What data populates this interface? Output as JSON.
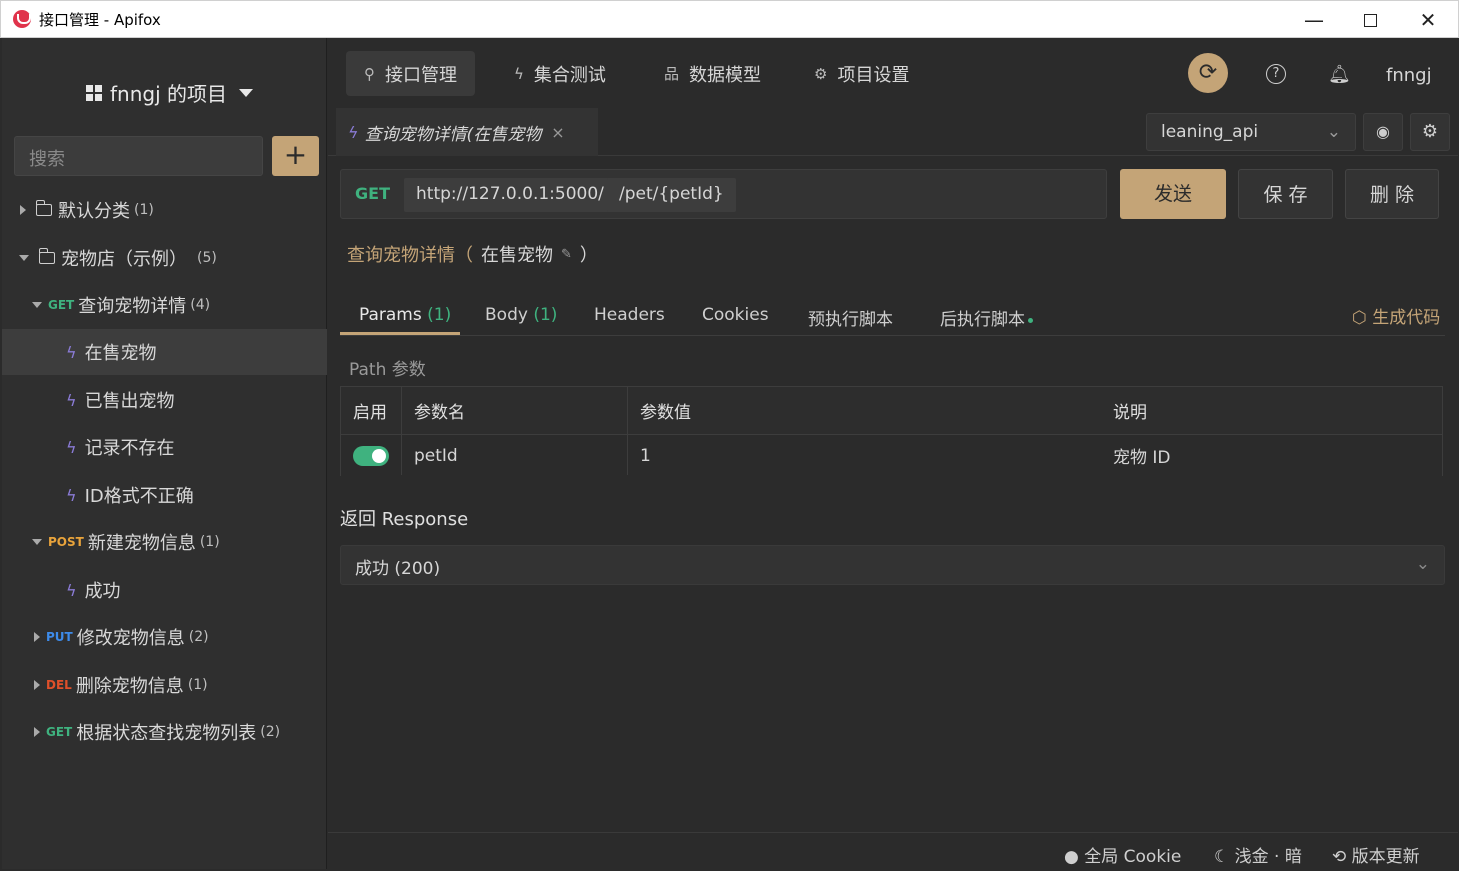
{
  "window": {
    "title": "接口管理 - Apifox",
    "minimize": "—",
    "close": "✕"
  },
  "sidebar": {
    "project_title": "fnngj 的项目",
    "search_placeholder": "搜索",
    "add": "+",
    "items": [
      {
        "label": "默认分类",
        "count": "(1)"
      },
      {
        "label": "宠物店（示例）",
        "count": "(5)"
      },
      {
        "method": "GET",
        "label": "查询宠物详情",
        "count": "(4)"
      },
      {
        "label": "在售宠物"
      },
      {
        "label": "已售出宠物"
      },
      {
        "label": "记录不存在"
      },
      {
        "label": "ID格式不正确"
      },
      {
        "method": "POST",
        "label": "新建宠物信息",
        "count": "(1)"
      },
      {
        "label": "成功"
      },
      {
        "method": "PUT",
        "label": "修改宠物信息",
        "count": "(2)"
      },
      {
        "method": "DEL",
        "label": "删除宠物信息",
        "count": "(1)"
      },
      {
        "method": "GET",
        "label": "根据状态查找宠物列表",
        "count": "(2)"
      }
    ]
  },
  "topnav": {
    "tabs": [
      {
        "label": "接口管理",
        "icon": "🔗"
      },
      {
        "label": "集合测试",
        "icon": "⚡"
      },
      {
        "label": "数据模型",
        "icon": "品"
      },
      {
        "label": "项目设置",
        "icon": "⚙"
      }
    ],
    "sync_icon": "⟳",
    "help_icon": "?",
    "bell_icon": "🔔",
    "user": "fnngj"
  },
  "tabstrip": {
    "doc_tab": "查询宠物详情(在售宠物",
    "close": "×",
    "env": "leaning_api",
    "chev": "⌄",
    "eye": "👁",
    "gear": "⚙"
  },
  "request": {
    "method": "GET",
    "base_url": "http://127.0.0.1:5000/",
    "path": "/pet/{petId}",
    "send": "发送",
    "save": "保 存",
    "delete": "删 除",
    "title": "查询宠物详情（",
    "case": "在售宠物",
    "edit": "✎",
    "title_close": "）"
  },
  "param_tabs": {
    "params": "Params",
    "params_count": "(1)",
    "body": "Body",
    "body_count": "(1)",
    "headers": "Headers",
    "cookies": "Cookies",
    "pre_script": "预执行脚本",
    "post_script": "后执行脚本",
    "gen_code": "生成代码"
  },
  "path_params": {
    "label": "Path 参数",
    "headers": [
      "启用",
      "参数名",
      "参数值",
      "说明"
    ],
    "rows": [
      {
        "enabled": true,
        "name": "petId",
        "value": "1",
        "desc": "宠物 ID"
      }
    ]
  },
  "response": {
    "label": "返回 Response",
    "selected": "成功 (200)"
  },
  "statusbar": {
    "cookie": "全局 Cookie",
    "theme": "浅金 · 暗",
    "update": "版本更新"
  },
  "colors": {
    "accent": "#c4a477",
    "get": "#3fb27f",
    "post": "#e8a33b",
    "put": "#3d8bea",
    "del": "#e0502a"
  }
}
